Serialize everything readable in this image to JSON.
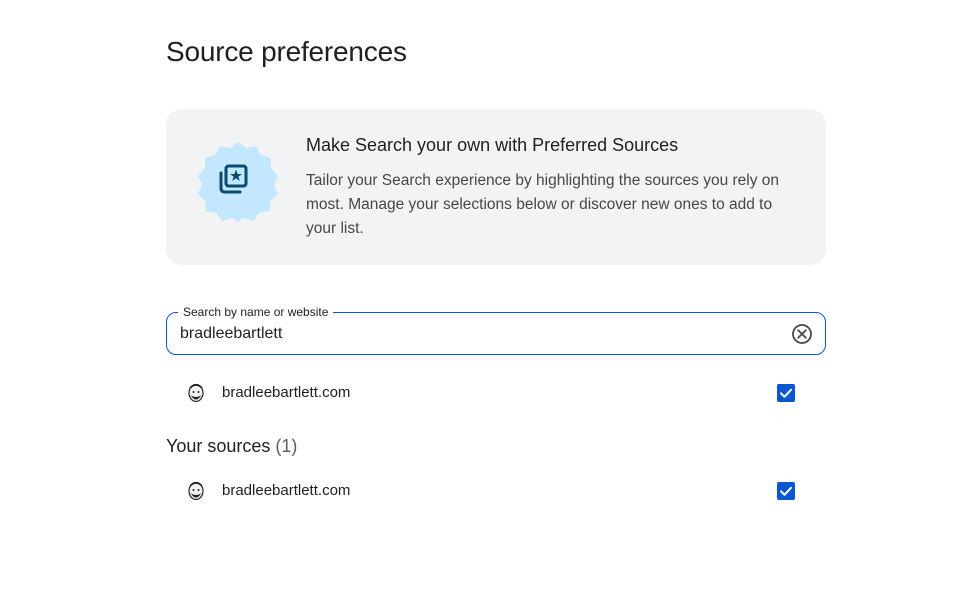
{
  "page": {
    "title": "Source preferences"
  },
  "promo": {
    "icon": "preferred-sources-badge-icon",
    "title": "Make Search your own with Preferred Sources",
    "body": "Tailor your Search experience by highlighting the sources you rely on most. Manage your selections below or discover new ones to add to your list."
  },
  "search": {
    "label": "Search by name or website",
    "value": "bradleebartlett",
    "clear_icon": "clear-circle-icon"
  },
  "results": [
    {
      "name": "bradleebartlett.com",
      "checked": true
    }
  ],
  "your_sources": {
    "heading": "Your sources",
    "count": "(1)",
    "items": [
      {
        "name": "bradleebartlett.com",
        "checked": true
      }
    ]
  },
  "colors": {
    "accent": "#0b57d0",
    "card_bg": "#f1f3f4",
    "badge_bg": "#c2e7ff",
    "badge_icon": "#0b4a6f"
  }
}
